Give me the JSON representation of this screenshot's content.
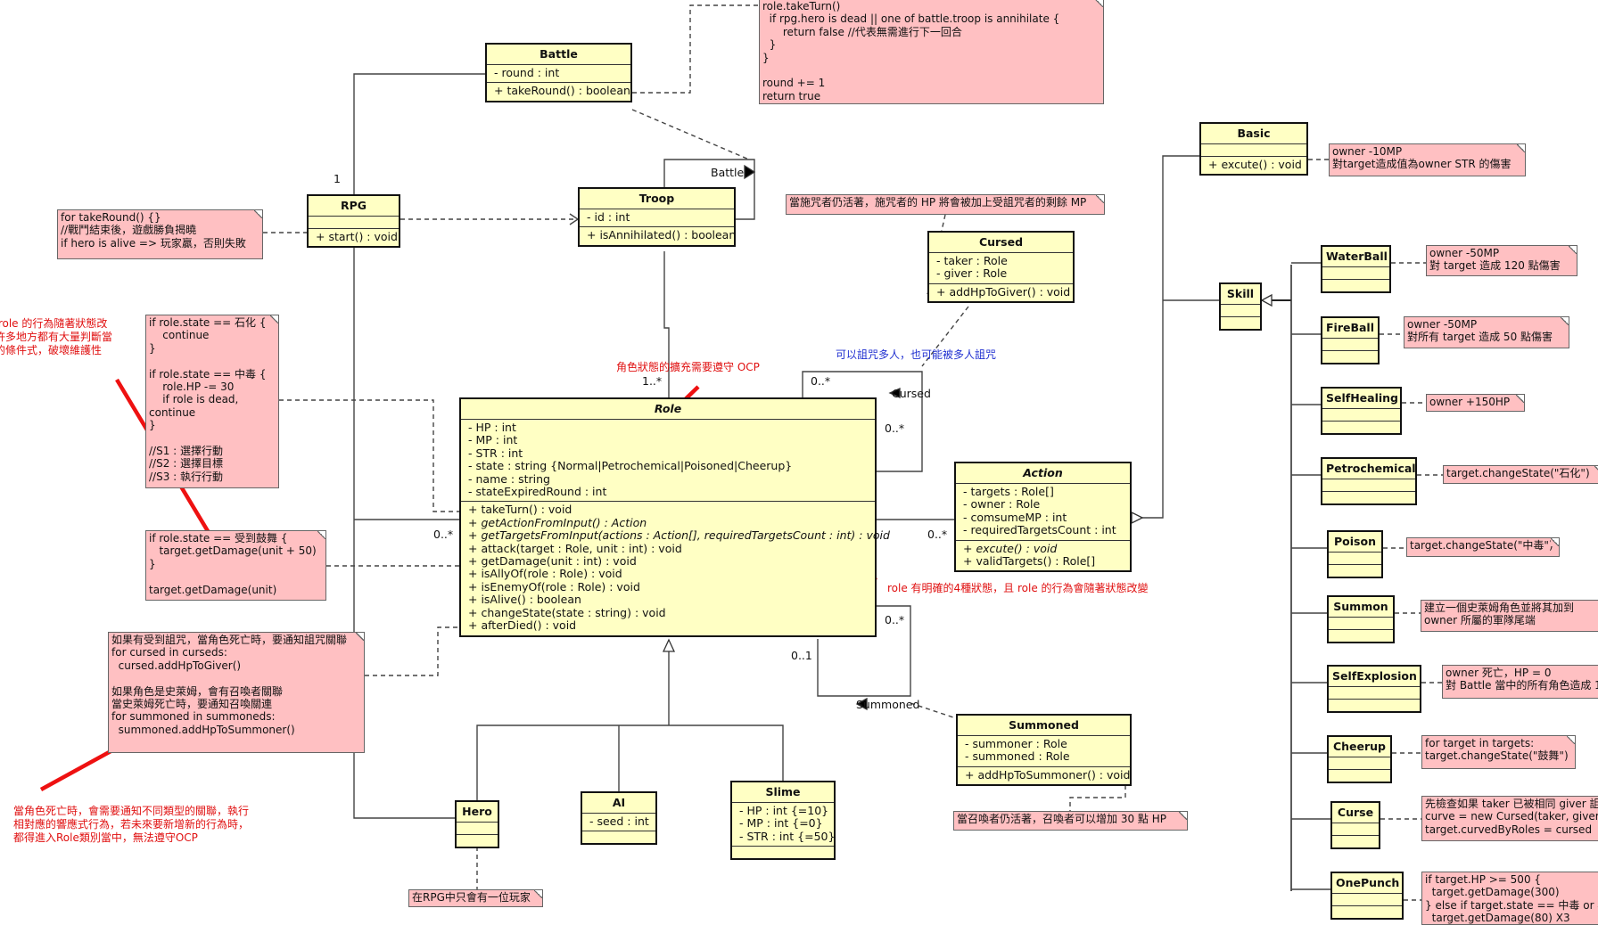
{
  "classes": {
    "battle": {
      "name": "Battle",
      "abstract": false,
      "attributes": [
        "- round : int"
      ],
      "methods": [
        {
          "text": "+ takeRound() : boolean",
          "abstract": false
        }
      ]
    },
    "rpg": {
      "name": "RPG",
      "abstract": false,
      "attributes": [],
      "methods": [
        {
          "text": "+ start() : void",
          "abstract": false
        }
      ]
    },
    "troop": {
      "name": "Troop",
      "abstract": false,
      "attributes": [
        "- id : int"
      ],
      "methods": [
        {
          "text": "+ isAnnihilated() : boolean",
          "abstract": false
        }
      ]
    },
    "cursed": {
      "name": "Cursed",
      "abstract": false,
      "attributes": [
        "- taker : Role",
        "- giver : Role"
      ],
      "methods": [
        {
          "text": "+ addHpToGiver() : void",
          "abstract": false
        }
      ]
    },
    "role": {
      "name": "Role",
      "abstract": true,
      "attributes": [
        "- HP : int",
        "- MP : int",
        "- STR : int",
        "- state : string {Normal|Petrochemical|Poisoned|Cheerup}",
        "- name : string",
        "- stateExpiredRound : int"
      ],
      "methods": [
        {
          "text": "+ takeTurn() : void",
          "abstract": false
        },
        {
          "text": "+ getActionFromInput() : Action",
          "abstract": true
        },
        {
          "text": "+ getTargetsFromInput(actions : Action[], requiredTargetsCount : int) : void",
          "abstract": true
        },
        {
          "text": "+ attack(target : Role, unit : int) : void",
          "abstract": false
        },
        {
          "text": "+ getDamage(unit : int) : void",
          "abstract": false
        },
        {
          "text": "+ isAllyOf(role : Role) : void",
          "abstract": false
        },
        {
          "text": "+ isEnemyOf(role : Role) : void",
          "abstract": false
        },
        {
          "text": "+ isAlive() : boolean",
          "abstract": false
        },
        {
          "text": "+ changeState(state : string) : void",
          "abstract": false
        },
        {
          "text": "+ afterDied() : void",
          "abstract": false
        }
      ]
    },
    "action": {
      "name": "Action",
      "abstract": true,
      "attributes": [
        "- targets : Role[]",
        "- owner : Role",
        "- comsumeMP : int",
        "- requiredTargetsCount : int"
      ],
      "methods": [
        {
          "text": "+ excute() : void",
          "abstract": true
        },
        {
          "text": "+ validTargets() : Role[]",
          "abstract": false
        }
      ]
    },
    "summoned": {
      "name": "Summoned",
      "abstract": false,
      "attributes": [
        "- summoner : Role",
        "- summoned : Role"
      ],
      "methods": [
        {
          "text": "+ addHpToSummoner() : void",
          "abstract": false
        }
      ]
    },
    "hero": {
      "name": "Hero",
      "abstract": false,
      "attributes": [],
      "methods": []
    },
    "ai": {
      "name": "AI",
      "abstract": false,
      "attributes": [
        "- seed : int"
      ],
      "methods": []
    },
    "slime": {
      "name": "Slime",
      "abstract": false,
      "attributes": [
        "- HP : int {=10}",
        "- MP : int {=0}",
        "- STR : int {=50}"
      ],
      "methods": []
    },
    "basic": {
      "name": "Basic",
      "abstract": false,
      "attributes": [],
      "methods": [
        {
          "text": "+ excute() : void",
          "abstract": false
        }
      ]
    },
    "skill": {
      "name": "Skill",
      "abstract": false,
      "attributes": [],
      "methods": []
    },
    "waterball": {
      "name": "WaterBall",
      "abstract": false,
      "attributes": [],
      "methods": []
    },
    "fireball": {
      "name": "FireBall",
      "abstract": false,
      "attributes": [],
      "methods": []
    },
    "selfhealing": {
      "name": "SelfHealing",
      "abstract": false,
      "attributes": [],
      "methods": []
    },
    "petrochemical": {
      "name": "Petrochemical",
      "abstract": false,
      "attributes": [],
      "methods": []
    },
    "poison": {
      "name": "Poison",
      "abstract": false,
      "attributes": [],
      "methods": []
    },
    "summon": {
      "name": "Summon",
      "abstract": false,
      "attributes": [],
      "methods": []
    },
    "selfexplosion": {
      "name": "SelfExplosion",
      "abstract": false,
      "attributes": [],
      "methods": []
    },
    "cheerup": {
      "name": "Cheerup",
      "abstract": false,
      "attributes": [],
      "methods": []
    },
    "curse": {
      "name": "Curse",
      "abstract": false,
      "attributes": [],
      "methods": []
    },
    "onepunch": {
      "name": "OnePunch",
      "abstract": false,
      "attributes": [],
      "methods": []
    }
  },
  "notes": {
    "take_round": "role.takeTurn()\n  if rpg.hero is dead || one of battle.troop is annihilate {\n      return false //代表無需進行下一回合\n  }\n}\n\nround += 1\nreturn true",
    "rpg_start": "for takeRound() {}\n//戰鬥結束後，遊戲勝負揭曉\nif hero is alive => 玩家贏，否則失敗",
    "cursed": "當施咒者仍活著，施咒者的 HP 將會被加上受詛咒者的剩餘 MP",
    "take_turn": "if role.state == 石化 {\n    continue\n}\n\nif role.state == 中毒 {\n    role.HP -= 30\n    if role is dead,\ncontinue\n}\n\n//S1 : 選擇行動\n//S2 : 選擇目標\n//S3 : 執行行動",
    "attack": "if role.state == 受到鼓舞 {\n   target.getDamage(unit + 50)\n}\n\ntarget.getDamage(unit)",
    "after_died": "如果有受到詛咒，當角色死亡時，要通知詛咒關聯\nfor cursed in curseds:\n  cursed.addHpToGiver()\n\n如果角色是史萊姆，會有召喚者關聯\n當史萊姆死亡時，要通知召喚關連\nfor summoned in summoneds:\n  summoned.addHpToSummoner()",
    "hero": "在RPG中只會有一位玩家",
    "summoned": "當召喚者仍活著，召喚者可以增加 30 點 HP",
    "basic": "owner -10MP\n對target造成值為owner STR 的傷害",
    "waterball": "owner -50MP\n對 target 造成 120 點傷害",
    "fireball": "owner -50MP\n對所有 target 造成 50 點傷害",
    "selfhealing": "owner +150HP",
    "petrochemical": "target.changeState(\"石化\")",
    "poison": "target.changeState(\"中毒\")",
    "summon": "建立一個史萊姆角色並將其加到\nowner 所屬的軍隊尾端",
    "selfexplosion": "owner 死亡，HP = 0\n對 Battle 當中的所有角色造成 1",
    "cheerup": "for target in targets:\ntarget.changeState(\"鼓舞\")",
    "curse": "先檢查如果 taker 已被相同 giver 詛\ncurve = new Cursed(taker, giver)\ntarget.curvedByRoles = cursed",
    "onepunch": "if target.HP >= 500 {\n  target.getDamage(300)\n} else if target.state == 中毒 or 石\n  target.getDamage(80) X3"
  },
  "labels": {
    "rpg_battle_mult": "1",
    "troop_mult": "1..*",
    "battle_assoc": "Battle",
    "cursed_assoc": "Cursed",
    "cursed_mult_top": "0..*",
    "cursed_mult_right": "0..*",
    "rpg_role_mult": "0..*",
    "action_mult": "0..*",
    "summoned_mult_many": "0..*",
    "summoned_mult_one": "0..1",
    "summoned_assoc": "Summoned"
  },
  "annotations": {
    "ocp_state": "角色狀態的擴充需要遵守 OCP",
    "four_states": "role 有明確的4種狀態，且 role 的行為會隨著狀態改變",
    "curse_many": "可以詛咒多人，也可能被多人詛咒",
    "left_top": "讓 role 的行為隨著狀態改\n在許多地方都有大量判斷當\n態的條件式，破壞維護性",
    "bottom_left": "當角色死亡時，會需要通知不同類型的關聯，執行\n相對應的響應式行為，若未來要新增新的行為時，\n都得進入Role類別當中，無法遵守OCP"
  },
  "colors": {
    "class_fill": "#ffffc4",
    "note_fill": "#ffc0c2",
    "annotation_red": "#e01010",
    "annotation_blue": "#2030d0",
    "arrow_red": "#ee1111"
  }
}
